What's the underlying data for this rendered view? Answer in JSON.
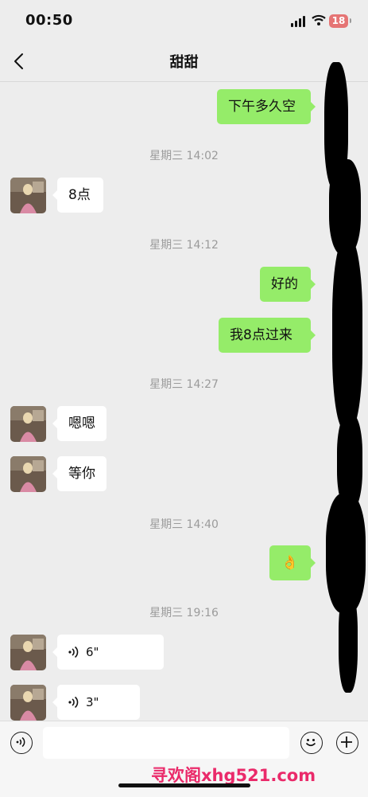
{
  "status_bar": {
    "time": "00:50",
    "battery": "18"
  },
  "header": {
    "title": "甜甜"
  },
  "messages": [
    {
      "type": "out",
      "text": "下午多久空"
    },
    {
      "type": "time",
      "text": "星期三 14:02"
    },
    {
      "type": "in",
      "text": "8点"
    },
    {
      "type": "time",
      "text": "星期三 14:12"
    },
    {
      "type": "out",
      "text": "好的"
    },
    {
      "type": "out",
      "text": "我8点过来"
    },
    {
      "type": "time",
      "text": "星期三 14:27"
    },
    {
      "type": "in",
      "text": "嗯嗯"
    },
    {
      "type": "in",
      "text": "等你"
    },
    {
      "type": "time",
      "text": "星期三 14:40"
    },
    {
      "type": "out",
      "text": "👌"
    },
    {
      "type": "time",
      "text": "星期三 19:16"
    },
    {
      "type": "in_voice",
      "text": "6\""
    },
    {
      "type": "in_voice",
      "text": "3\""
    }
  ],
  "input_bar": {
    "placeholder": ""
  },
  "watermark": "寻欢阁xhg521.com",
  "colors": {
    "sent_bubble": "#95ec69",
    "received_bubble": "#ffffff",
    "background": "#ededed",
    "watermark": "#ea2a6a"
  }
}
